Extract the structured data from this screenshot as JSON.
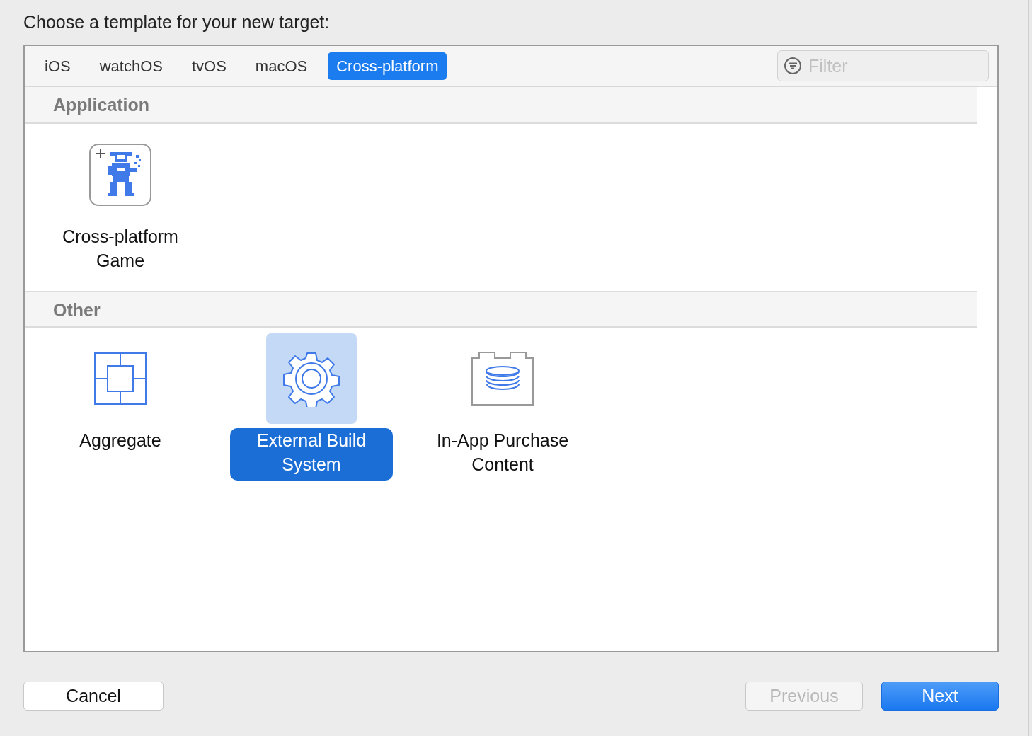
{
  "heading": "Choose a template for your new target:",
  "tabs": [
    {
      "label": "iOS",
      "selected": false
    },
    {
      "label": "watchOS",
      "selected": false
    },
    {
      "label": "tvOS",
      "selected": false
    },
    {
      "label": "macOS",
      "selected": false
    },
    {
      "label": "Cross-platform",
      "selected": true
    }
  ],
  "filter": {
    "placeholder": "Filter"
  },
  "sections": [
    {
      "title": "Application",
      "items": [
        {
          "kind": "game",
          "label": "Cross-platform Game",
          "selected": false
        }
      ]
    },
    {
      "title": "Other",
      "items": [
        {
          "kind": "aggregate",
          "label": "Aggregate",
          "selected": false
        },
        {
          "kind": "gear",
          "label": "External Build System",
          "selected": true
        },
        {
          "kind": "purchase",
          "label": "In-App Purchase Content",
          "selected": false
        }
      ]
    }
  ],
  "buttons": [
    {
      "label": "Cancel",
      "kind": "normal",
      "disabled": false
    },
    {
      "label": "Previous",
      "kind": "normal",
      "disabled": true
    },
    {
      "label": "Next",
      "kind": "default",
      "disabled": false
    }
  ]
}
